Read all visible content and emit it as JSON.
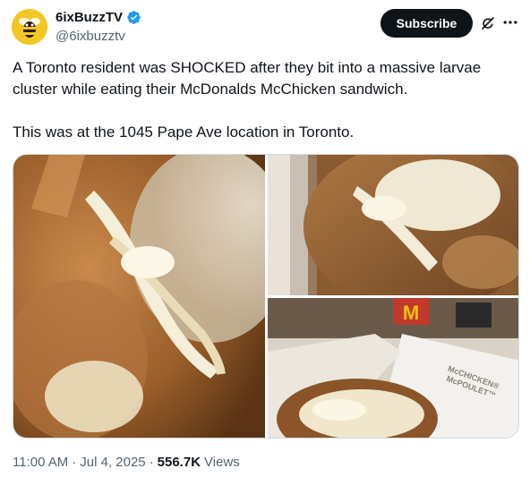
{
  "account": {
    "display_name": "6ixBuzzTV",
    "handle": "@6ixbuzztv",
    "verified": true,
    "avatar_icon": "bee-logo-icon",
    "avatar_color": "#f3c623"
  },
  "actions": {
    "subscribe_label": "Subscribe",
    "grok_icon": "grok-icon",
    "more_icon": "more-horizontal-icon"
  },
  "tweet": {
    "paragraphs": [
      "A Toronto resident was SHOCKED after they bit into a massive larvae cluster while eating their McDonalds McChicken sandwich.",
      "This was at the 1045 Pape Ave location in Toronto."
    ]
  },
  "media": {
    "images": [
      {
        "name": "closeup-sandwich-larvae"
      },
      {
        "name": "sandwich-in-box"
      },
      {
        "name": "sandwich-with-box-label",
        "box_text": "McCHICKEN® McPOULET™"
      }
    ]
  },
  "meta": {
    "time": "11:00 AM",
    "separator": "·",
    "date": "Jul 4, 2025",
    "views_count": "556.7K",
    "views_label": "Views"
  },
  "colors": {
    "text_primary": "#0f1419",
    "text_secondary": "#536471",
    "verified_blue": "#1d9bf0",
    "button_bg": "#0f1419"
  }
}
